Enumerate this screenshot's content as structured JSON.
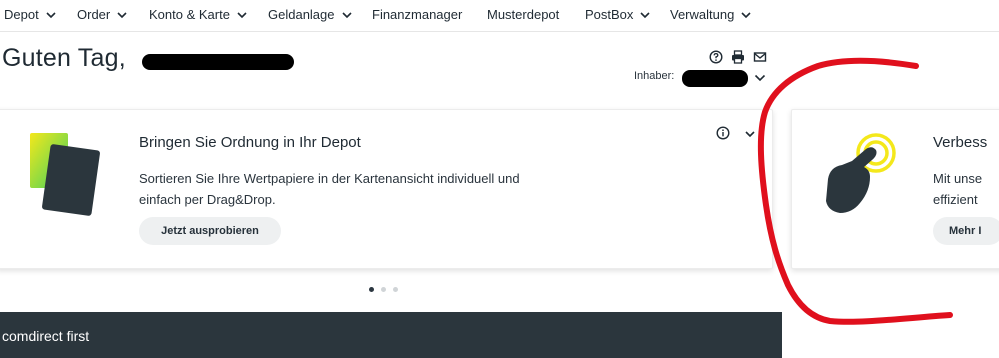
{
  "nav": {
    "items": [
      {
        "label": "Depot",
        "dropdown": true
      },
      {
        "label": "Order",
        "dropdown": true
      },
      {
        "label": "Konto & Karte",
        "dropdown": true
      },
      {
        "label": "Geldanlage",
        "dropdown": true
      },
      {
        "label": "Finanzmanager",
        "dropdown": false
      },
      {
        "label": "Musterdepot",
        "dropdown": false
      },
      {
        "label": "PostBox",
        "dropdown": true
      },
      {
        "label": "Verwaltung",
        "dropdown": true
      }
    ]
  },
  "header": {
    "greeting": "Guten Tag,",
    "owner_label": "Inhaber:"
  },
  "card_main": {
    "title": "Bringen Sie Ordnung in Ihr Depot",
    "text": "Sortieren Sie Ihre Wertpapiere in der Kartenansicht individuell und einfach per Drag&Drop.",
    "button": "Jetzt ausprobieren",
    "info_icon": "info-icon"
  },
  "card_next": {
    "title_partial": "Verbess",
    "text_line1": "Mit unse",
    "text_line2": "effizient",
    "button_partial": "Mehr I"
  },
  "carousel": {
    "slides": 3,
    "active": 1
  },
  "banner": {
    "label": "comdirect first"
  },
  "colors": {
    "dark": "#2b363d",
    "accent_yellow": "#f4e81b",
    "accent_green": "#48d15e",
    "annotation_red": "#e0101d"
  }
}
